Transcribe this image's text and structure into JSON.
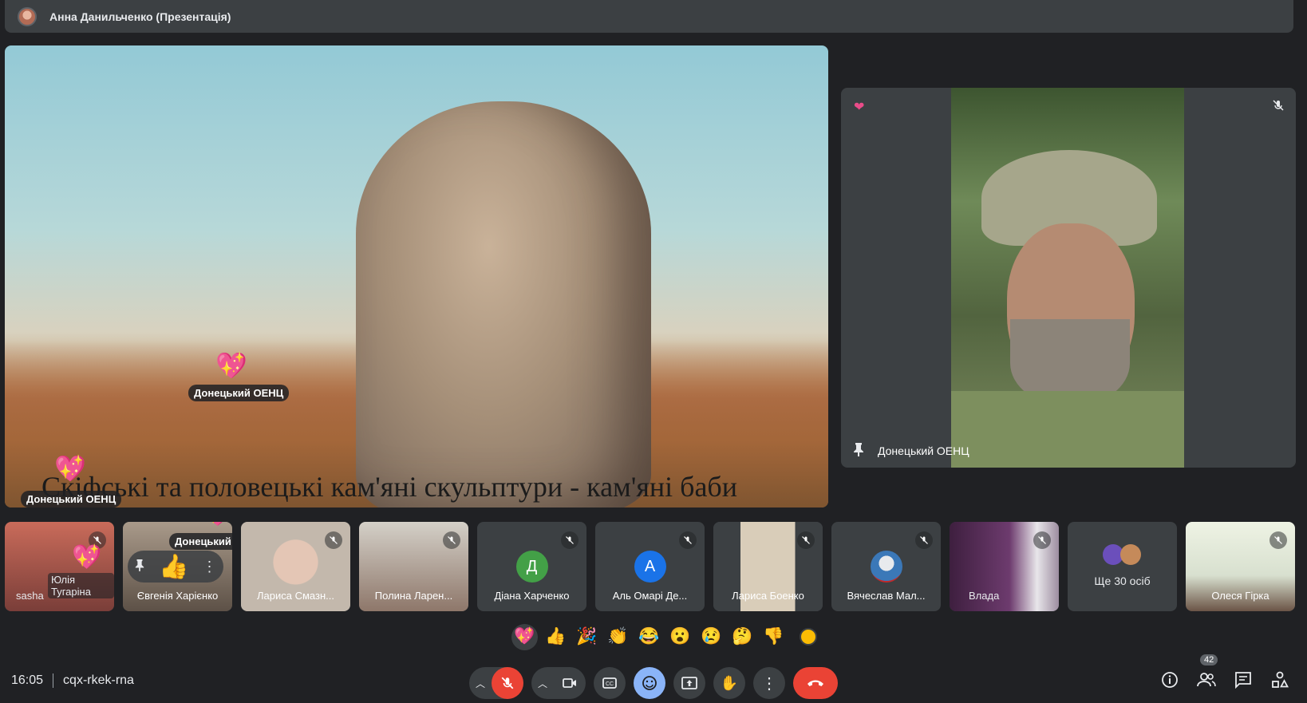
{
  "presenter_bar": {
    "title": "Анна Данильченко (Презентація)"
  },
  "presentation": {
    "caption": "Скіфські та половецькі кам'яні скульптури - кам'яні баби",
    "reaction_labels": [
      "Донецький ОЕНЦ",
      "Донецький ОЕНЦ",
      "Донецький ОЕНЦ"
    ]
  },
  "speaker": {
    "name": "Донецький ОЕНЦ"
  },
  "participants": [
    {
      "name": "sasha",
      "extra": "Юлія Тугаріна",
      "muted": true
    },
    {
      "name": "Євгенія Харієнко",
      "muted": false
    },
    {
      "name": "Лариса Смазн...",
      "muted": true
    },
    {
      "name": "Полина Ларен...",
      "muted": true
    },
    {
      "name": "Діана Харченко",
      "initial": "Д",
      "color": "#43a047",
      "muted": true
    },
    {
      "name": "Аль Омарі Де...",
      "initial": "A",
      "color": "#1a73e8",
      "muted": true
    },
    {
      "name": "Лариса Боенко",
      "muted": true
    },
    {
      "name": "Вячеслав Мал...",
      "muted": true
    },
    {
      "name": "Влада",
      "muted": true
    },
    {
      "name": "Ще 30 осіб"
    },
    {
      "name": "Олеся Гірка",
      "muted": true
    }
  ],
  "reactions": [
    "💖",
    "👍",
    "🎉",
    "👏",
    "😂",
    "😮",
    "😢",
    "🤔",
    "👎"
  ],
  "meeting": {
    "time": "16:05",
    "code": "cqx-rkek-rna"
  },
  "people_count": "42",
  "colors": {
    "end_call": "#ea4335",
    "active": "#8ab4f8",
    "bg": "#202124",
    "tile": "#3c4043"
  }
}
